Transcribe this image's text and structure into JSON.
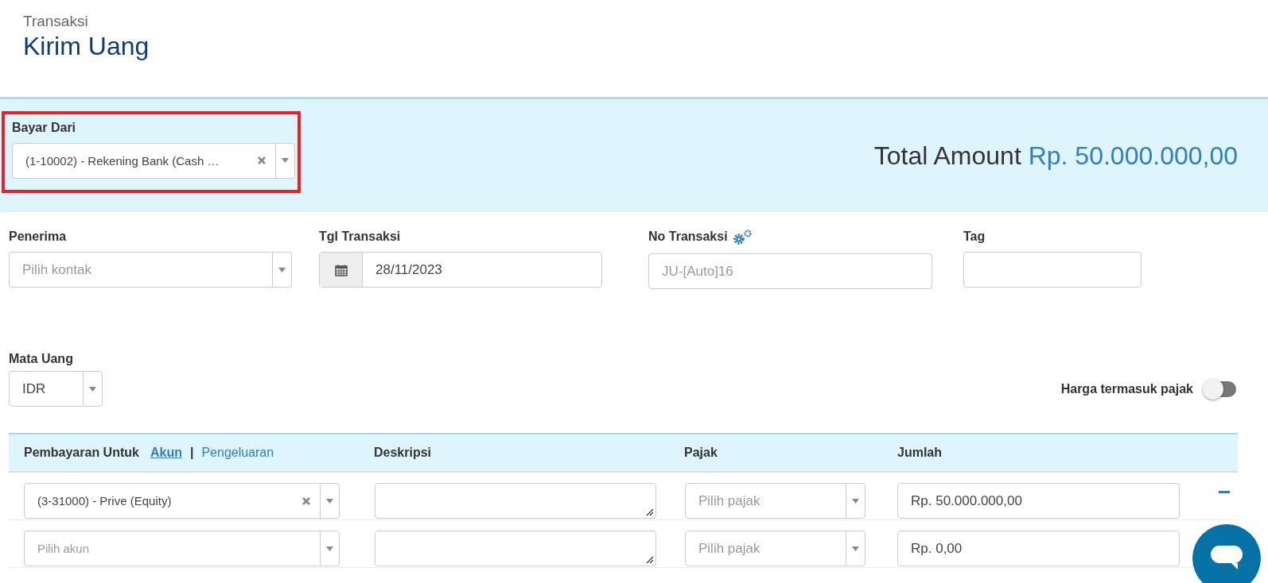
{
  "header": {
    "breadcrumb": "Transaksi",
    "title": "Kirim Uang"
  },
  "pay_from": {
    "label": "Bayar Dari",
    "value": "(1-10002) - Rekening Bank (Cash …",
    "highlighted": true
  },
  "total": {
    "label": "Total Amount",
    "amount": "Rp. 50.000.000,00"
  },
  "fields": [
    {
      "kind": "select",
      "label": "Penerima",
      "placeholder": "Pilih kontak"
    },
    {
      "kind": "date",
      "label": "Tgl Transaksi",
      "value": "28/11/2023"
    },
    {
      "kind": "text",
      "label": "No Transaksi",
      "placeholder": "JU-[Auto]16",
      "settings": true
    },
    {
      "kind": "text",
      "label": "Tag"
    }
  ],
  "currency": {
    "label": "Mata Uang",
    "value": "IDR"
  },
  "tax_inclusive": {
    "label": "Harga termasuk pajak",
    "on": false
  },
  "table": {
    "columns": [
      "Pembayaran Untuk",
      "Deskripsi",
      "Pajak",
      "Jumlah"
    ],
    "modes": [
      {
        "label": "Akun",
        "selected": true
      },
      {
        "label": "Pengeluaran",
        "selected": false
      }
    ],
    "separator": "|",
    "rows": [
      {
        "account": {
          "value": "(3-31000) - Prive (Equity)"
        },
        "tax": {
          "placeholder": "Pilih pajak"
        },
        "amount": "Rp. 50.000.000,00",
        "removable": true
      },
      {
        "account": {
          "placeholder": "Pilih akun"
        },
        "tax": {
          "placeholder": "Pilih pajak"
        },
        "amount": "Rp. 0,00"
      }
    ]
  }
}
